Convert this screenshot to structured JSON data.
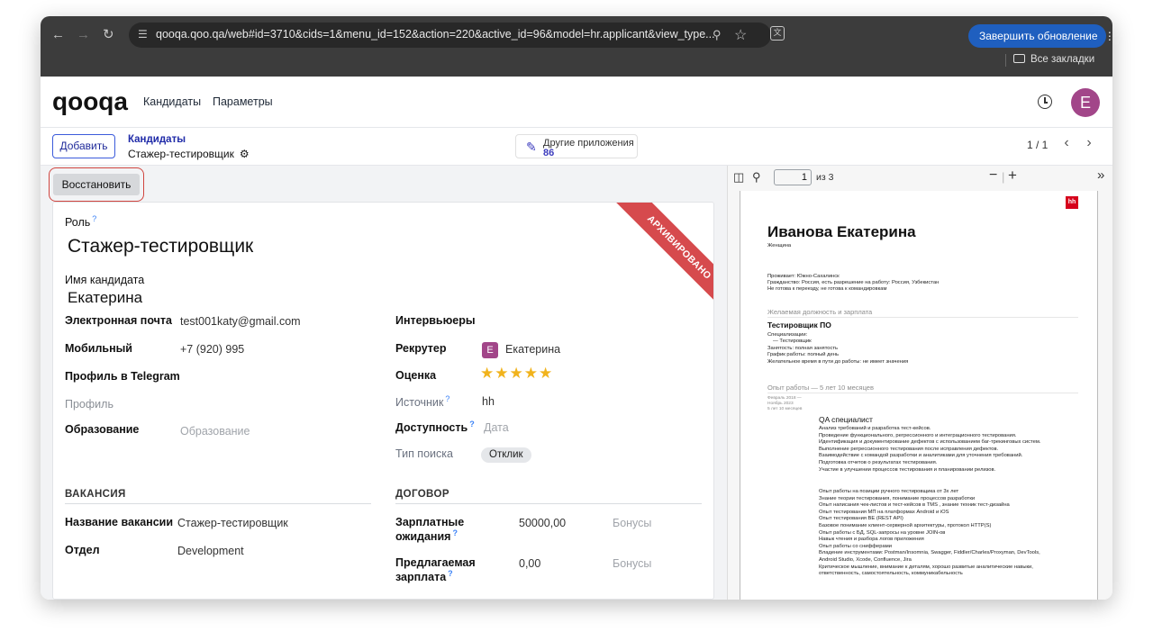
{
  "browser": {
    "url": "qooqa.qoo.qa/web#id=3710&cids=1&menu_id=152&action=220&active_id=96&model=hr.applicant&view_type...",
    "update_button": "Завершить обновление",
    "bookmarks_label": "Все закладки"
  },
  "app": {
    "logo": "qooqa",
    "menu": [
      "Кандидаты",
      "Параметры"
    ],
    "user_initial": "E"
  },
  "control": {
    "add_button": "Добавить",
    "breadcrumb_parent": "Кандидаты",
    "breadcrumb_current": "Стажер-тестировщик",
    "other_apps_label": "Другие приложения",
    "other_apps_count": "86",
    "pager": "1 / 1"
  },
  "form": {
    "restore_button": "Восстановить",
    "ribbon": "АРХИВИРОВАНО",
    "role_label": "Роль",
    "role_value": "Стажер-тестировщик",
    "candidate_label": "Имя кандидата",
    "candidate_value": "Екатерина",
    "email_label": "Электронная почта",
    "email_value": "test001katy@gmail.com",
    "mobile_label": "Мобильный",
    "mobile_value": "+7 (920) 995",
    "telegram_label": "Профиль в Telegram",
    "profile_label": "Профиль",
    "education_label": "Образование",
    "education_placeholder": "Образование",
    "interviewers_label": "Интервьюеры",
    "recruiter_label": "Рекрутер",
    "recruiter_initial": "E",
    "recruiter_value": "Екатерина",
    "rating_label": "Оценка",
    "rating_stars": 5,
    "source_label": "Источник",
    "source_value": "hh",
    "availability_label": "Доступность",
    "availability_placeholder": "Дата",
    "search_type_label": "Тип поиска",
    "search_type_value": "Отклик",
    "vacancy_section": "ВАКАНСИЯ",
    "contract_section": "ДОГОВОР",
    "vacancy_name_label": "Название вакансии",
    "vacancy_name_value": "Стажер-тестировщик",
    "department_label": "Отдел",
    "department_value": "Development",
    "salary_expected_label_1": "Зарплатные",
    "salary_expected_label_2": "ожидания",
    "salary_expected_value": "50000,00",
    "salary_offered_label_1": "Предлагаемая",
    "salary_offered_label_2": "зарплата",
    "salary_offered_value": "0,00",
    "bonus_placeholder": "Бонусы"
  },
  "pdf": {
    "page_input": "1",
    "page_of": "из 3",
    "cv": {
      "name": "Иванова Екатерина",
      "gender": "Женщина",
      "lives": "Проживает: Южно-Сахалинск",
      "citizenship": "Гражданство: Россия, есть разрешение на работу: Россия, Узбекистан",
      "relocation": "Не готова к переезду, не готова к командировкам",
      "section_position": "Желаемая должность и зарплата",
      "position": "Тестировщик ПО",
      "spec_lines": [
        "Специализации:",
        "— Тестировщик",
        "Занятость: полная занятость",
        "График работы: полный день",
        "Желательное время в пути до работы: не имеет значения"
      ],
      "section_experience": "Опыт работы — 5 лет 10 месяцев",
      "period_lines": [
        "Февраль 2018 —",
        "Ноябрь 2023",
        "5 лет 10 месяцев"
      ],
      "job_title": "QA специалист",
      "duties_1": [
        "Анализ требований и разработка тест-кейсов.",
        "Проведение функционального, регрессионного и интеграционного тестирования.",
        "Идентификация и документирование дефектов с использованием баг-трекинговых систем.",
        "Выполнение регрессионного тестирования после исправления дефектов.",
        "Взаимодействие с командой разработки и аналитиками для уточнения требований.",
        "Подготовка отчетов о результатах тестирования.",
        "Участие в улучшении процессов тестирования и планировании релизов."
      ],
      "duties_2": [
        "Опыт работы на позиции ручного тестировщика от 3х лет",
        "Знание теории тестирования, понимание процессов разработки",
        "Опыт написания чек-листов и тест-кейсов в TMS , знание техник тест-дизайна",
        "Опыт тестирования МП на платформах Android и iOS",
        "Опыт тестирования BE (REST API)",
        "Базовое понимание клиент-серверной архитектуры, протокол HTTP(S)",
        "Опыт работы с БД, SQL-запросы на уровне JOIN-ов",
        "Навык чтения и разбора логов приложения",
        "Опыт работы со снифферами",
        "Владение инструментами: Postman/Insomnia, Swagger, Fiddler/Charles/Proxyman, DevTools,",
        "Android Studio, Xcode, Confluence, Jira",
        "Критическое мышление, внимание к деталям, хорошо развитые аналитические навыки,",
        "ответственность, самостоятельность, коммуникабельность"
      ]
    }
  }
}
